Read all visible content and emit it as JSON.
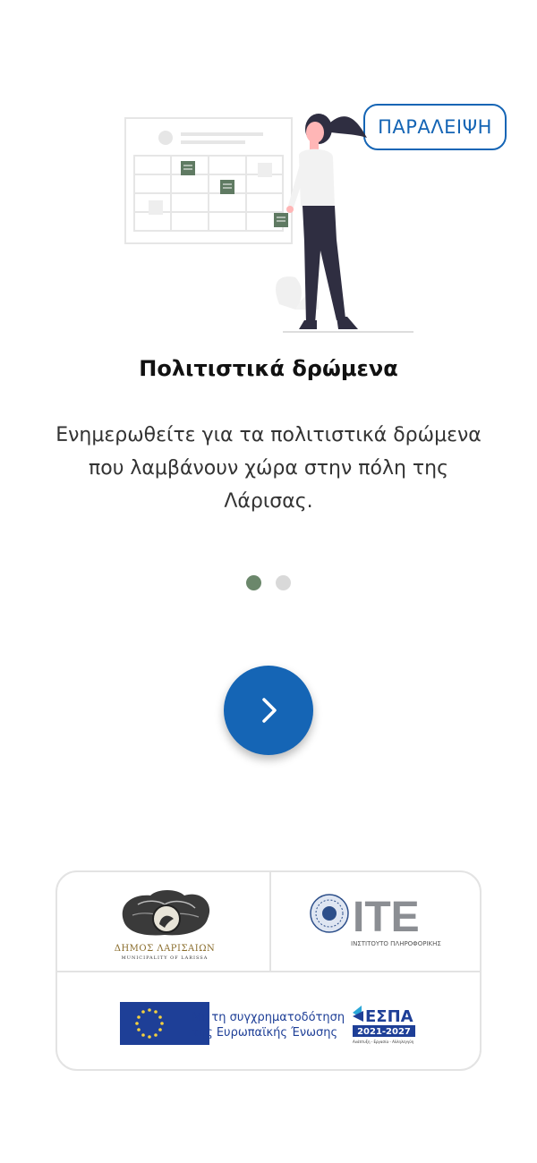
{
  "header": {
    "skip_label": "ΠΑΡΑΛΕΙΨΗ"
  },
  "slide": {
    "title": "Πολιτιστικά δρώμενα",
    "description": "Ενημερωθείτε για τα πολιτιστικά δρώμενα που λαμβάνουν χώρα στην πόλη της Λάρισας.",
    "current_index": 1,
    "total": 2
  },
  "navigation": {
    "next_icon": "chevron-right-icon"
  },
  "footer": {
    "municipality_name": "ΔΗΜΟΣ ΛΑΡΙΣΑΙΩΝ",
    "municipality_sub": "MUNICIPALITY OF LARISSA",
    "institute_logo_text": "ΙΤΕ",
    "institute_name": "ΙΝΣΤΙΤΟΥΤΟ ΠΛΗΡΟΦΟΡΙΚΗΣ",
    "eu_line1": "Με τη συγχρηματοδότηση",
    "eu_line2": "της Ευρωπαϊκής Ένωσης",
    "espa_title": "ΕΣΠΑ",
    "espa_years": "2021-2027",
    "espa_tagline": "Ανάπτυξη - Εργασία - Αλληλεγγύη"
  },
  "colors": {
    "primary": "#1565b5",
    "dot_active": "#6b876b",
    "dot_inactive": "#d9d9d9",
    "eu_blue": "#1e3f97",
    "eu_star": "#f4d03f"
  }
}
